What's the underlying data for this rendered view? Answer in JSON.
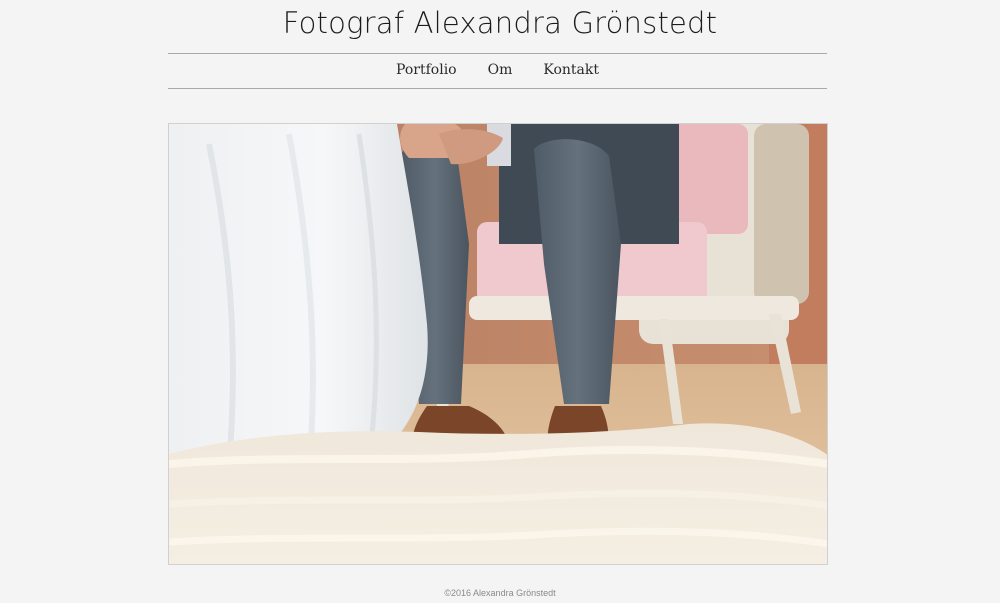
{
  "site": {
    "title": "Fotograf Alexandra Grönstedt"
  },
  "nav": {
    "items": [
      {
        "label": "Portfolio"
      },
      {
        "label": "Om"
      },
      {
        "label": "Kontakt"
      }
    ]
  },
  "footer": {
    "copyright": "©2016 Alexandra Grönstedt"
  },
  "colors": {
    "background": "#f4f4f4",
    "rule": "#a9a9a9",
    "text": "#1c1c1c"
  }
}
